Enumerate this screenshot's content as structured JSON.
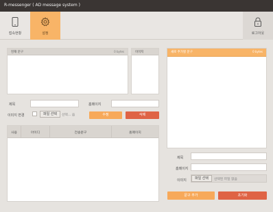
{
  "window": {
    "title": "R-messenger ( AD message system )"
  },
  "toolbar": {
    "items": [
      {
        "label": "접속현황",
        "icon": "phone-icon",
        "active": false
      },
      {
        "label": "설정",
        "icon": "gear-icon",
        "active": true
      }
    ],
    "logout": {
      "label": "로그아웃",
      "icon": "lock-icon"
    }
  },
  "current_message": {
    "title": "현재 문구",
    "bytes": "0 bytes"
  },
  "image_panel": {
    "title": "이미지"
  },
  "left_form": {
    "subject_label": "제목",
    "homepage_label": "홈페이지",
    "image_change_label": "이미지 변경",
    "file_button": "파일 선택",
    "file_status": "선택... 음",
    "edit_button": "수정",
    "delete_button": "삭제"
  },
  "table": {
    "columns": [
      "사용",
      "아이디",
      "전송문구",
      "홈페이지"
    ],
    "rows": []
  },
  "new_message": {
    "title": "새로 추가할 문구",
    "bytes": "0 bytes"
  },
  "right_form": {
    "subject_label": "제목",
    "homepage_label": "홈페이지",
    "image_label": "이미지",
    "file_button": "파일 선택",
    "file_status": "선택된 파일 없음",
    "add_button": "문구 추가",
    "reset_button": "초기화"
  },
  "colors": {
    "accent": "#f8b467",
    "danger": "#df6345",
    "titlebar": "#3a3533"
  }
}
